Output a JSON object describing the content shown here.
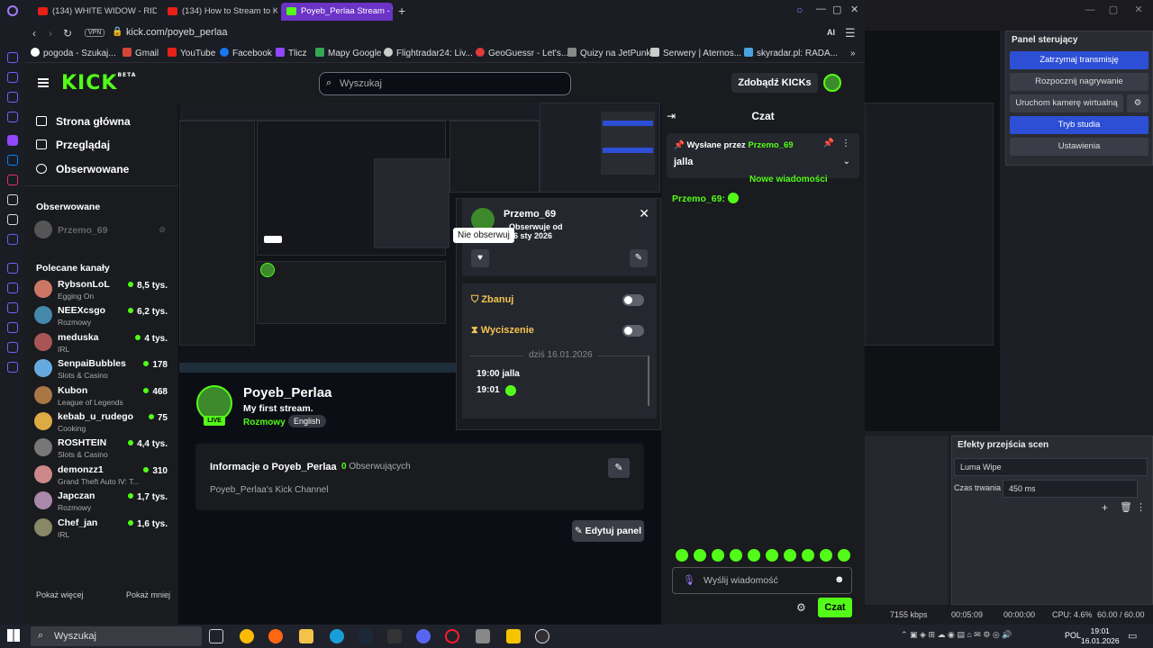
{
  "browser": {
    "tabs": [
      {
        "label": "(134) WHITE WIDOW - RID"
      },
      {
        "label": "(134) How to Stream to Ki"
      },
      {
        "label": "Poyeb_Perlaa Stream - Wa"
      }
    ],
    "vpn": "VPN",
    "url": "kick.com/poyeb_perlaa",
    "ai": "AI",
    "bookmarks": [
      "pogoda - Szukaj...",
      "Gmail",
      "YouTube",
      "Facebook",
      "Tlicz",
      "Mapy Google",
      "Flightradar24: Liv...",
      "GeoGuessr - Let's...",
      "Quizy na JetPunk",
      "Serwery | Aternos...",
      "skyradar.pl: RADA..."
    ]
  },
  "kick": {
    "logo": "KICK",
    "logo_sup": "BETA",
    "search_placeholder": "Wyszukaj",
    "kicks_button": "Zdobądź KICKs",
    "nav": {
      "home": "Strona główna",
      "browse": "Przeglądaj",
      "following": "Obserwowane"
    },
    "following_header": "Obserwowane",
    "following_channel": "Przemo_69",
    "recommended_header": "Polecane kanały",
    "channels": [
      {
        "name": "RybsonLoL",
        "category": "Egging On",
        "viewers": "8,5 tys."
      },
      {
        "name": "NEEXcsgo",
        "category": "Rozmowy",
        "viewers": "6,2 tys."
      },
      {
        "name": "meduska",
        "category": "IRL",
        "viewers": "4 tys."
      },
      {
        "name": "SenpaiBubbles",
        "category": "Slots & Casino",
        "viewers": "178"
      },
      {
        "name": "Kubon",
        "category": "League of Legends",
        "viewers": "468"
      },
      {
        "name": "kebab_u_rudego",
        "category": "Cooking",
        "viewers": "75"
      },
      {
        "name": "ROSHTEIN",
        "category": "Slots & Casino",
        "viewers": "4,4 tys."
      },
      {
        "name": "demonzz1",
        "category": "Grand Theft Auto IV: T...",
        "viewers": "310"
      },
      {
        "name": "Japczan",
        "category": "Rozmowy",
        "viewers": "1,7 tys."
      },
      {
        "name": "Chef_jan",
        "category": "IRL",
        "viewers": "1,6 tys."
      }
    ],
    "show_more": "Pokaż więcej",
    "show_less": "Pokaż mniej",
    "popup": {
      "name": "Przemo_69",
      "follow_line1": "Obserwuje od",
      "follow_line2": "16 sty 2026",
      "tooltip": "Nie obserwuj",
      "ban": "Zbanuj",
      "mute": "Wyciszenie",
      "log_date": "dziś 16.01.2026",
      "log": [
        {
          "time": "19:00",
          "text": "jalla"
        },
        {
          "time": "19:01",
          "text": ""
        }
      ]
    },
    "channel": {
      "name": "Poyeb_Perlaa",
      "title": "My first stream.",
      "category": "Rozmowy",
      "language": "English",
      "live": "LIVE",
      "info_title": "Informacje o Poyeb_Perlaa",
      "followers_count": "0",
      "followers_label": "Obserwujących",
      "description": "Poyeb_Perlaa's Kick Channel",
      "edit_panel": "Edytuj panel"
    },
    "chat": {
      "header": "Czat",
      "pinned_by": "Wysłane przez",
      "pinned_user": "Przemo_69",
      "pinned_msg": "jalla",
      "new_messages": "Nowe wiadomości",
      "message_user": "Przemo_69:",
      "input_placeholder": "Wyślij wiadomość",
      "send": "Czat"
    }
  },
  "obs": {
    "controls_title": "Panel sterujący",
    "buttons": [
      "Zatrzymaj transmisję",
      "Rozpocznij nagrywanie",
      "Uruchom kamerę wirtualną",
      "Tryb studia",
      "Ustawienia"
    ],
    "transitions_title": "Efekty przejścia scen",
    "transition": "Luma Wipe",
    "duration_label": "Czas trwania",
    "duration": "450 ms",
    "status": {
      "bitrate": "7155 kbps",
      "stream_time": "00:05:09",
      "rec_time": "00:00:00",
      "cpu": "CPU: 4.6%",
      "fps": "60.00 / 60.00 FPS"
    }
  },
  "taskbar": {
    "search": "Wyszukaj",
    "lang": "POL",
    "time": "19:01",
    "date": "16.01.2026"
  }
}
